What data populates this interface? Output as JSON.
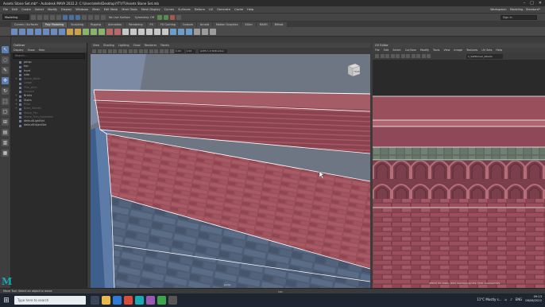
{
  "window": {
    "title": "Assets Stone Set.mb* - Autodesk MAYA 2022.2: C:\\Users\\defe\\Desktop\\YT\\YT\\Assets Stone Set.mb",
    "controls": [
      "–",
      "□",
      "✕"
    ]
  },
  "menubar": {
    "items": [
      "File",
      "Edit",
      "Create",
      "Select",
      "Modify",
      "Display",
      "Windows",
      "Mesh",
      "Edit Mesh",
      "Mesh Tools",
      "Mesh Display",
      "Curves",
      "Surfaces",
      "Deform",
      "UV",
      "Generate",
      "Cache",
      "Help"
    ],
    "workspace_label": "Workspace:",
    "workspace_value": "Modeling - Standard*"
  },
  "statusline": {
    "mode": "Modeling",
    "no_live_surface": "No Live Surface",
    "symmetry": "Symmetry: Off",
    "sign_in": "Sign In"
  },
  "shelf": {
    "tabs": [
      "Curves / Surfaces",
      "Poly Modeling",
      "Sculpting",
      "Rigging",
      "Animation",
      "Rendering",
      "FX",
      "FX Caching",
      "Custom",
      "Arnold",
      "Motion Graphics",
      "XGen",
      "MASH",
      "Bifrost"
    ],
    "active_tab_index": 1
  },
  "outliner": {
    "title": "Outliner",
    "menu": [
      "Display",
      "Show",
      "Help"
    ],
    "search_placeholder": "Search...",
    "items": [
      {
        "label": "persp",
        "dim": false,
        "expandable": false
      },
      {
        "label": "top",
        "dim": false,
        "expandable": false
      },
      {
        "label": "front",
        "dim": false,
        "expandable": false
      },
      {
        "label": "side",
        "dim": false,
        "expandable": false
      },
      {
        "label": "Stone_Walls",
        "dim": true,
        "expandable": true
      },
      {
        "label": "Ledge",
        "dim": true,
        "expandable": false
      },
      {
        "label": "Trim_Arch",
        "dim": true,
        "expandable": false
      },
      {
        "label": "Cornice",
        "dim": true,
        "expandable": false
      },
      {
        "label": "Bricks",
        "dim": false,
        "expandable": true
      },
      {
        "label": "Stairs",
        "dim": false,
        "expandable": true
      },
      {
        "label": "Pillar",
        "dim": true,
        "expandable": true
      },
      {
        "label": "Base_Stones",
        "dim": true,
        "expandable": true
      },
      {
        "label": "Stone_Tile",
        "dim": true,
        "expandable": false
      },
      {
        "label": "Stone_Trim_Extended",
        "dim": true,
        "expandable": false
      },
      {
        "label": "defaultLightSet",
        "dim": false,
        "expandable": false
      },
      {
        "label": "defaultObjectSet",
        "dim": false,
        "expandable": false
      }
    ]
  },
  "viewport": {
    "menu": [
      "View",
      "Shading",
      "Lighting",
      "Show",
      "Renderer",
      "Panels"
    ],
    "fields": [
      "0.00",
      "1.00"
    ],
    "camera_select": "ACES 1.0 SDR-video (sRGB)",
    "camera_label": "persp",
    "viewcube_label": "FRONT"
  },
  "uv_editor": {
    "title": "UV Editor",
    "menu": [
      "File",
      "Edit",
      "Select",
      "Cut/Sew",
      "Modify",
      "Tools",
      "View",
      "Image",
      "Textures",
      "UV Sets",
      "Help"
    ],
    "texture_select": "1_SetStone2_Albedo",
    "status": "(8914) UV shells, (0/0) overlapping UVs, (0/0) reversed UVs"
  },
  "helpline": {
    "text": "Move Tool: Select an object to move.",
    "mel_label": "MEL"
  },
  "taskbar": {
    "search_placeholder": "Type here to search",
    "weather": "11°C  Mostly s...",
    "lang": "ENG",
    "time": "09:13",
    "date": "08/08/2022"
  },
  "colors": {
    "brick": "#9b4f5a",
    "stone": "#4f5f78",
    "maya_teal": "#1ba8b5"
  }
}
